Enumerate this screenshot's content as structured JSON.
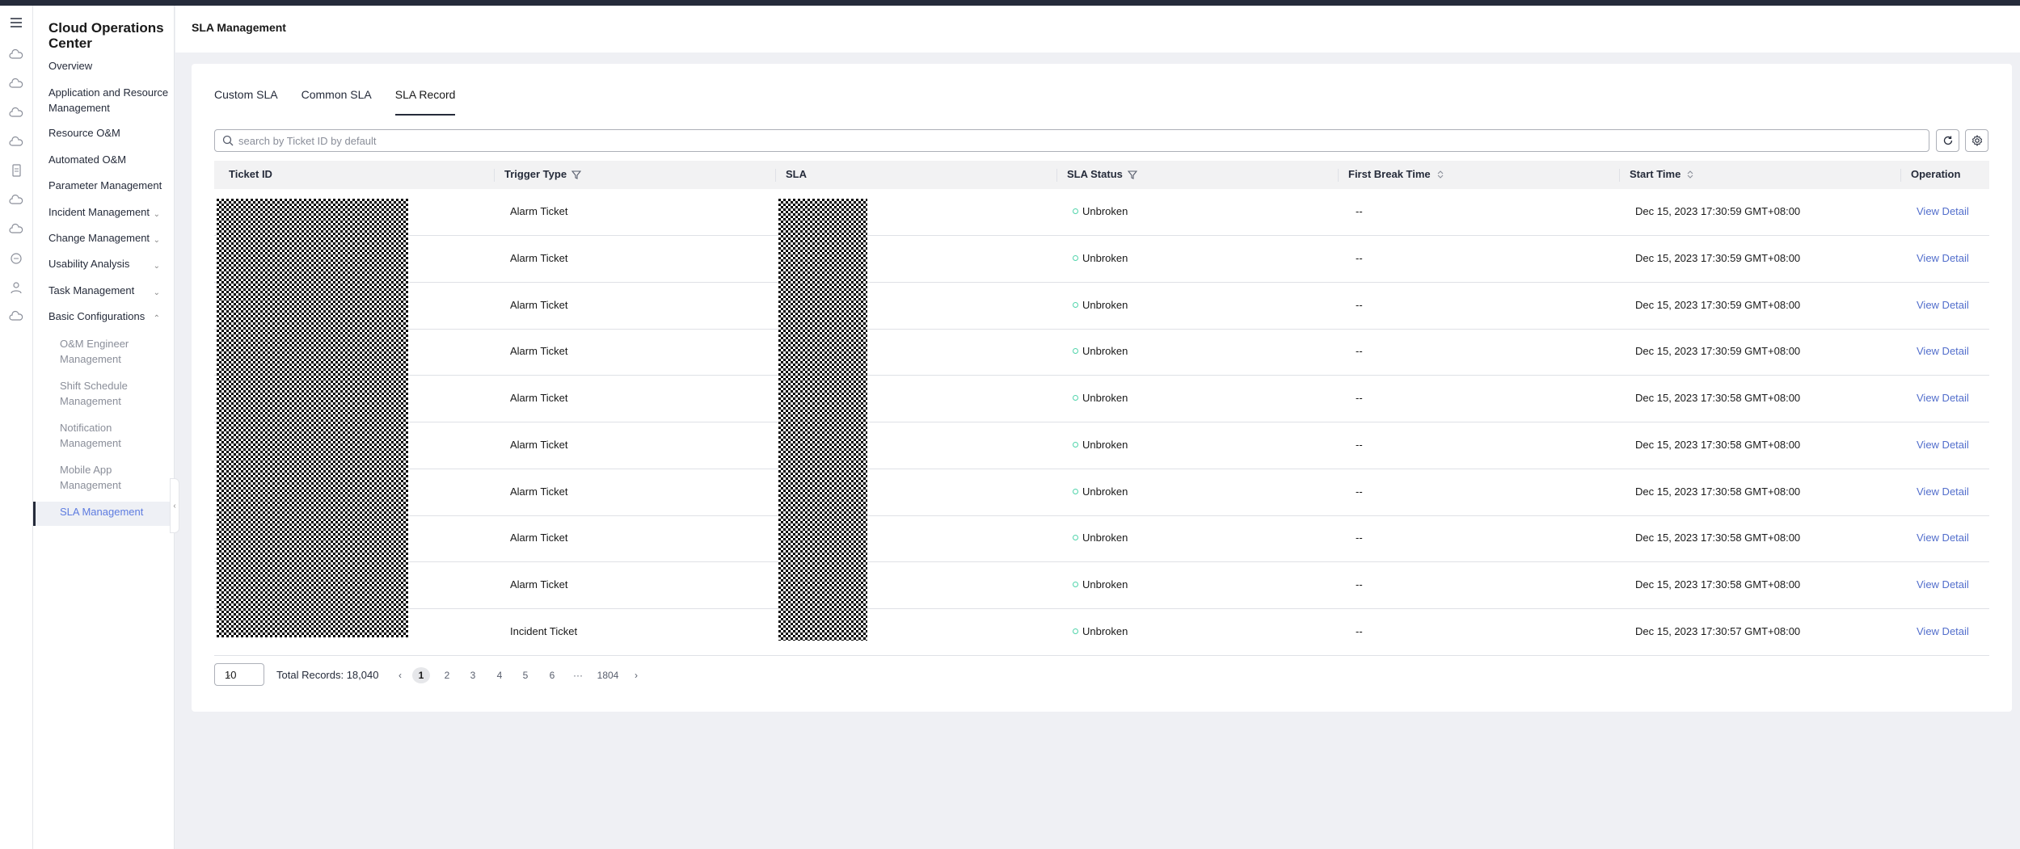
{
  "app": {
    "title": "Cloud Operations Center",
    "page_title": "SLA Management"
  },
  "icon_rail": [
    "menu-icon",
    "cloud-icon",
    "cloud-icon",
    "cloud-icon",
    "cloud-icon",
    "document-icon",
    "cloud-icon",
    "cloud-icon",
    "chat-icon",
    "user-icon",
    "cloud-icon"
  ],
  "sidebar": {
    "items": [
      {
        "label": "Overview"
      },
      {
        "label": "Application and Resource Management"
      },
      {
        "label": "Resource O&M"
      },
      {
        "label": "Automated O&M"
      },
      {
        "label": "Parameter Management"
      },
      {
        "label": "Incident Management"
      },
      {
        "label": "Change Management"
      },
      {
        "label": "Usability Analysis"
      },
      {
        "label": "Task Management"
      },
      {
        "label": "Basic Configurations"
      }
    ],
    "sub_items": [
      {
        "label": "O&M Engineer Management"
      },
      {
        "label": "Shift Schedule Management"
      },
      {
        "label": "Notification Management"
      },
      {
        "label": "Mobile App Management"
      }
    ],
    "active_item": "SLA Management"
  },
  "tabs": [
    {
      "label": "Custom SLA"
    },
    {
      "label": "Common SLA"
    },
    {
      "label": "SLA Record"
    }
  ],
  "search": {
    "placeholder": "search by Ticket ID by default",
    "value": ""
  },
  "table": {
    "columns": [
      {
        "label": "Ticket ID"
      },
      {
        "label": "Trigger Type"
      },
      {
        "label": "SLA"
      },
      {
        "label": "SLA Status"
      },
      {
        "label": "First Break Time"
      },
      {
        "label": "Start Time"
      },
      {
        "label": "Operation"
      }
    ],
    "rows": [
      {
        "trigger_type": "Alarm Ticket",
        "status": "Unbroken",
        "first_break": "--",
        "start_time": "Dec 15, 2023 17:30:59 GMT+08:00",
        "operation": "View Detail"
      },
      {
        "trigger_type": "Alarm Ticket",
        "status": "Unbroken",
        "first_break": "--",
        "start_time": "Dec 15, 2023 17:30:59 GMT+08:00",
        "operation": "View Detail"
      },
      {
        "trigger_type": "Alarm Ticket",
        "status": "Unbroken",
        "first_break": "--",
        "start_time": "Dec 15, 2023 17:30:59 GMT+08:00",
        "operation": "View Detail"
      },
      {
        "trigger_type": "Alarm Ticket",
        "status": "Unbroken",
        "first_break": "--",
        "start_time": "Dec 15, 2023 17:30:59 GMT+08:00",
        "operation": "View Detail"
      },
      {
        "trigger_type": "Alarm Ticket",
        "status": "Unbroken",
        "first_break": "--",
        "start_time": "Dec 15, 2023 17:30:58 GMT+08:00",
        "operation": "View Detail"
      },
      {
        "trigger_type": "Alarm Ticket",
        "status": "Unbroken",
        "first_break": "--",
        "start_time": "Dec 15, 2023 17:30:58 GMT+08:00",
        "operation": "View Detail"
      },
      {
        "trigger_type": "Alarm Ticket",
        "status": "Unbroken",
        "first_break": "--",
        "start_time": "Dec 15, 2023 17:30:58 GMT+08:00",
        "operation": "View Detail"
      },
      {
        "trigger_type": "Alarm Ticket",
        "status": "Unbroken",
        "first_break": "--",
        "start_time": "Dec 15, 2023 17:30:58 GMT+08:00",
        "operation": "View Detail"
      },
      {
        "trigger_type": "Alarm Ticket",
        "status": "Unbroken",
        "first_break": "--",
        "start_time": "Dec 15, 2023 17:30:58 GMT+08:00",
        "operation": "View Detail"
      },
      {
        "trigger_type": "Incident Ticket",
        "status": "Unbroken",
        "first_break": "--",
        "start_time": "Dec 15, 2023 17:30:57 GMT+08:00",
        "operation": "View Detail"
      }
    ]
  },
  "pagination": {
    "page_size": "10",
    "total_label": "Total Records: 18,040",
    "pages": [
      "1",
      "2",
      "3",
      "4",
      "5",
      "6",
      "···",
      "1804"
    ],
    "current": "1"
  },
  "colors": {
    "accent": "#5e7ce0",
    "link": "#526ecc",
    "status_ok": "#50d4ab",
    "topbar": "#252b3a"
  }
}
